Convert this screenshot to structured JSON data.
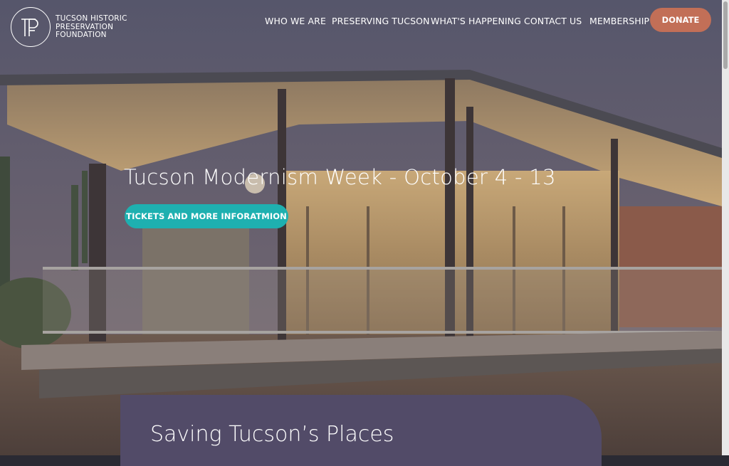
{
  "brand": {
    "line1": "TUCSON HISTORIC",
    "line2": "PRESERVATION",
    "line3": "FOUNDATION",
    "logo_icon": "thpf-monogram-icon"
  },
  "nav": {
    "items": [
      {
        "label": "WHO WE ARE"
      },
      {
        "label": "PRESERVING TUCSON"
      },
      {
        "label": "WHAT'S HAPPENING"
      },
      {
        "label": "CONTACT US"
      },
      {
        "label": "MEMBERSHIP"
      }
    ],
    "donate_label": "DONATE"
  },
  "hero": {
    "headline": "Tucson Modernism Week - October 4 - 13",
    "cta_label": "TICKETS AND MORE INFORATMION"
  },
  "section": {
    "title": "Saving Tucson’s Places"
  },
  "colors": {
    "donate": "#c26f57",
    "cta": "#1eb0b0",
    "card": "#524b68"
  }
}
